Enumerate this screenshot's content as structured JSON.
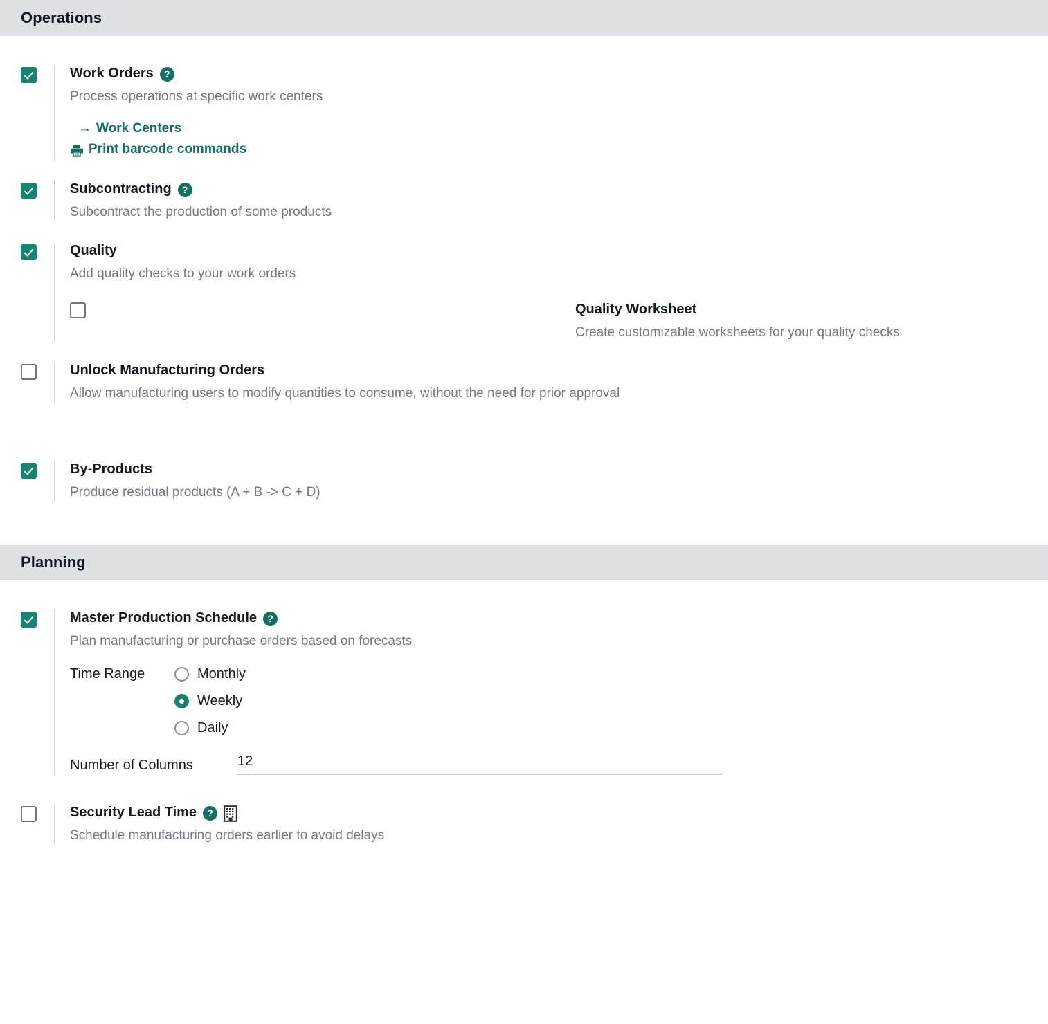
{
  "sections": [
    {
      "id": "operations",
      "title": "Operations",
      "settings": [
        {
          "id": "work_orders",
          "checked": true,
          "title": "Work Orders",
          "help": true,
          "description": "Process operations at specific work centers",
          "links": [
            {
              "id": "work_centers",
              "icon": "arrow-right-icon",
              "label": "Work Centers"
            },
            {
              "id": "print_barcode",
              "icon": "printer-icon",
              "label": "Print barcode commands"
            }
          ]
        },
        {
          "id": "subcontracting",
          "checked": true,
          "title": "Subcontracting",
          "help": true,
          "description": "Subcontract the production of some products"
        },
        {
          "id": "quality",
          "checked": true,
          "title": "Quality",
          "help": false,
          "description": "Add quality checks to your work orders",
          "sub_option": {
            "id": "quality_worksheet",
            "checked": false,
            "title": "Quality Worksheet",
            "description": "Create customizable worksheets for your quality checks"
          }
        },
        {
          "id": "unlock_manufacturing_orders",
          "checked": false,
          "title": "Unlock Manufacturing Orders",
          "help": false,
          "description": "Allow manufacturing users to modify quantities to consume, without the need for prior approval"
        },
        {
          "id": "by_products",
          "checked": true,
          "title": "By-Products",
          "help": false,
          "description": "Produce residual products (A + B -> C + D)"
        }
      ]
    },
    {
      "id": "planning",
      "title": "Planning",
      "settings": [
        {
          "id": "master_production_schedule",
          "checked": true,
          "title": "Master Production Schedule",
          "help": true,
          "description": "Plan manufacturing or purchase orders based on forecasts",
          "time_range": {
            "label": "Time Range",
            "options": [
              {
                "id": "monthly",
                "label": "Monthly",
                "selected": false
              },
              {
                "id": "weekly",
                "label": "Weekly",
                "selected": true
              },
              {
                "id": "daily",
                "label": "Daily",
                "selected": false
              }
            ]
          },
          "number_of_columns": {
            "label": "Number of Columns",
            "value": "12"
          }
        },
        {
          "id": "security_lead_time",
          "checked": false,
          "title": "Security Lead Time",
          "help": true,
          "company_icon": true,
          "description": "Schedule manufacturing orders earlier to avoid delays"
        }
      ]
    }
  ],
  "icons": {
    "help": "?",
    "arrow_right": "→",
    "printer": "printer-icon",
    "company": "company-icon"
  },
  "colors": {
    "accent": "#17846f",
    "accent_dark": "#176e62",
    "header_bg": "#dee0e3",
    "muted_text": "#76797f",
    "title_text": "#16191d",
    "checkbox_border": "#6f7680"
  }
}
